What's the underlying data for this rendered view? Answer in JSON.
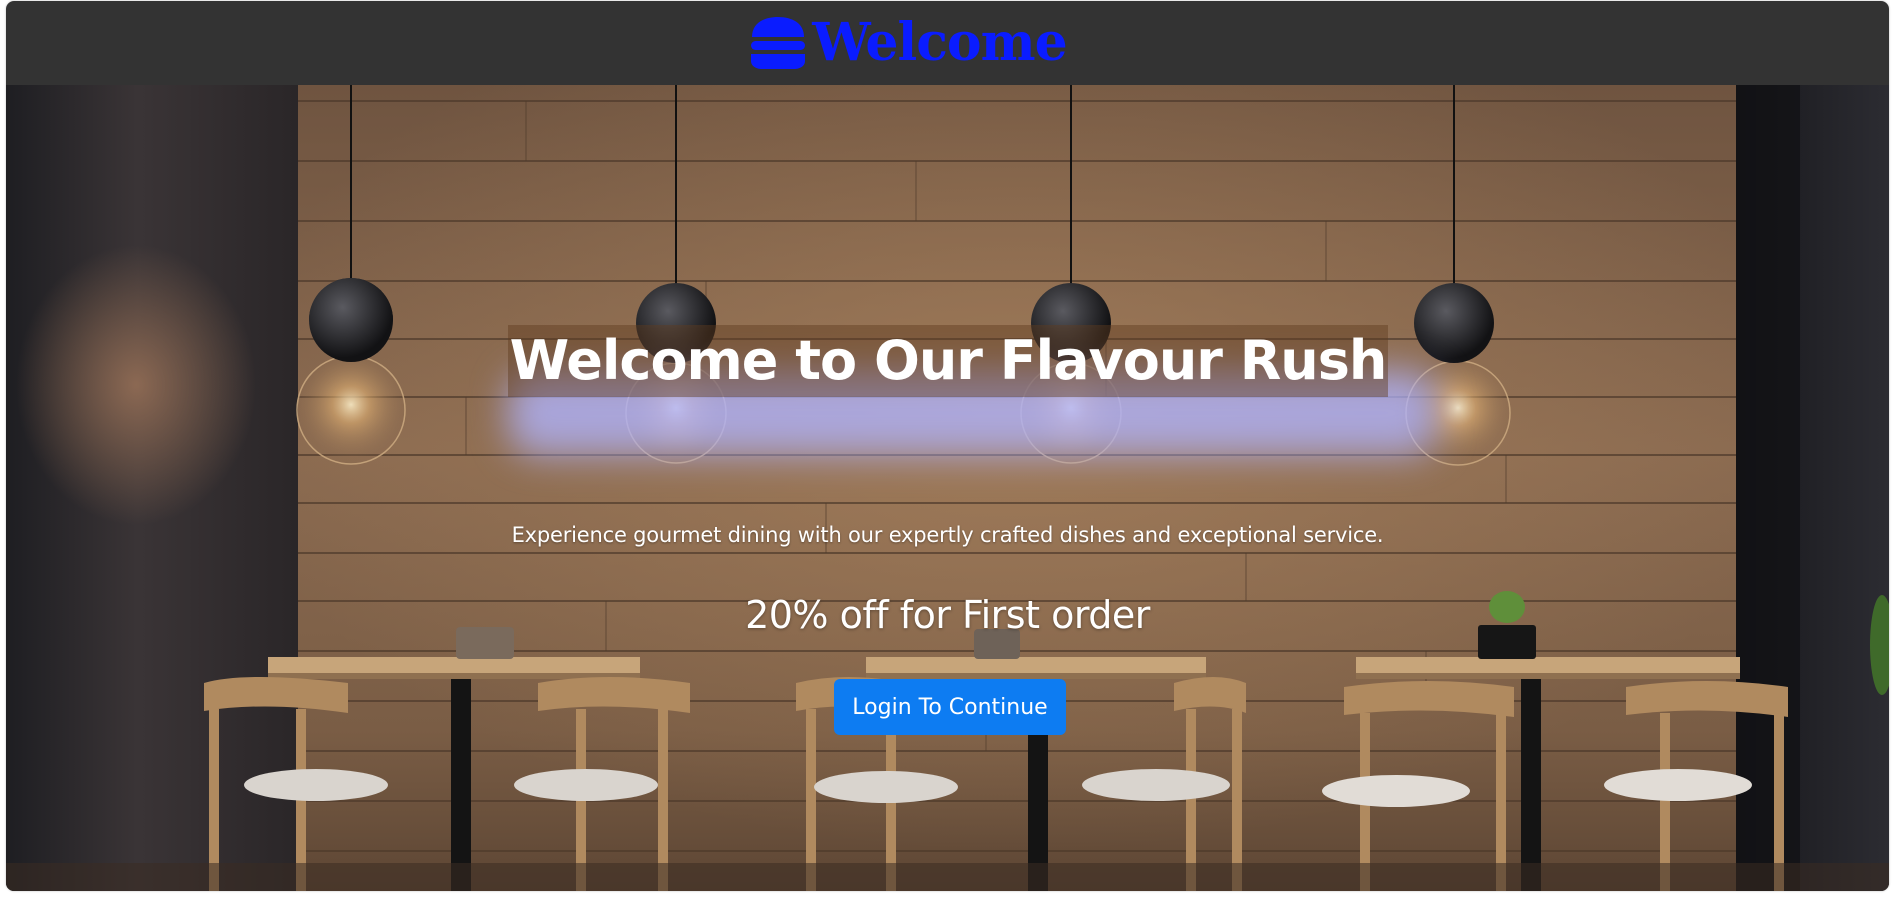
{
  "navbar": {
    "brand_icon": "burger-icon",
    "brand_text": "Welcome",
    "brand_color": "#0a1cff",
    "background": "#333333"
  },
  "hero": {
    "title": "Welcome to Our Flavour Rush",
    "subtitle": "Experience gourmet dining with our expertly crafted dishes and exceptional service.",
    "offer": "20% off for First order",
    "login_button": "Login To Continue",
    "button_color": "#0d7cf2"
  }
}
